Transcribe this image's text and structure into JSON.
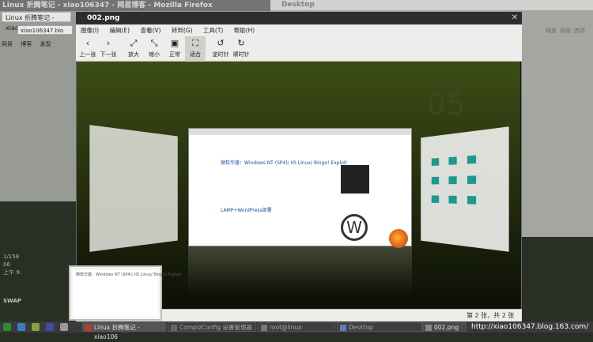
{
  "firefox_bg": {
    "title": "Linux 折腾笔记 - xiao106347 - 网易博客 - Mozilla Firefox",
    "tab": "Linux 折腾笔记 - xiao10",
    "url": "xiao106347.blo",
    "menu": [
      "网易",
      "博客",
      "发现"
    ]
  },
  "desktop_bg": {
    "title": "Desktop",
    "tools": [
      "缩放",
      "前视",
      "选项"
    ]
  },
  "viewer": {
    "title": "002.png",
    "menu": [
      "图像(I)",
      "编辑(E)",
      "查看(V)",
      "转到(G)",
      "工具(T)",
      "帮助(H)"
    ],
    "toolbar": [
      {
        "label": "上一张",
        "icon": "‹"
      },
      {
        "label": "下一张",
        "icon": "›"
      },
      {
        "label": "放大",
        "icon": "⤢"
      },
      {
        "label": "缩小",
        "icon": "⤡"
      },
      {
        "label": "正常",
        "icon": "▣"
      },
      {
        "label": "适合",
        "icon": "⛶"
      },
      {
        "label": "逆时针",
        "icon": "↺"
      },
      {
        "label": "顺时针",
        "icon": "↻"
      }
    ],
    "status": "第 2 张，共 2 张"
  },
  "canvas": {
    "doc_heading": "微软华盛：Windows NT (SP4)/ IIS Linux/ Bingo! Exploit",
    "doc_heading2": "LAMP+WordPress部署",
    "big_num": "05"
  },
  "conky": {
    "lines": [
      "1/158",
      "06",
      "上午 9:"
    ],
    "swap": "SWAP"
  },
  "taskbar": {
    "tasks": [
      {
        "label": "Linux 折腾笔记 - xiao106",
        "color": "#c0392b"
      },
      {
        "label": "CompizConfig 设置管理器",
        "color": "#666666"
      },
      {
        "label": "root@linux",
        "color": "#777777"
      },
      {
        "label": "Desktop",
        "color": "#5a7fb0"
      },
      {
        "label": "002.png",
        "color": "#888888"
      }
    ],
    "blog": "http://xiao106347.blog.163.com/",
    "tray_colors": [
      "#2e8b2e",
      "#3a7fc0",
      "#8aa038",
      "#3a4fa0"
    ]
  }
}
